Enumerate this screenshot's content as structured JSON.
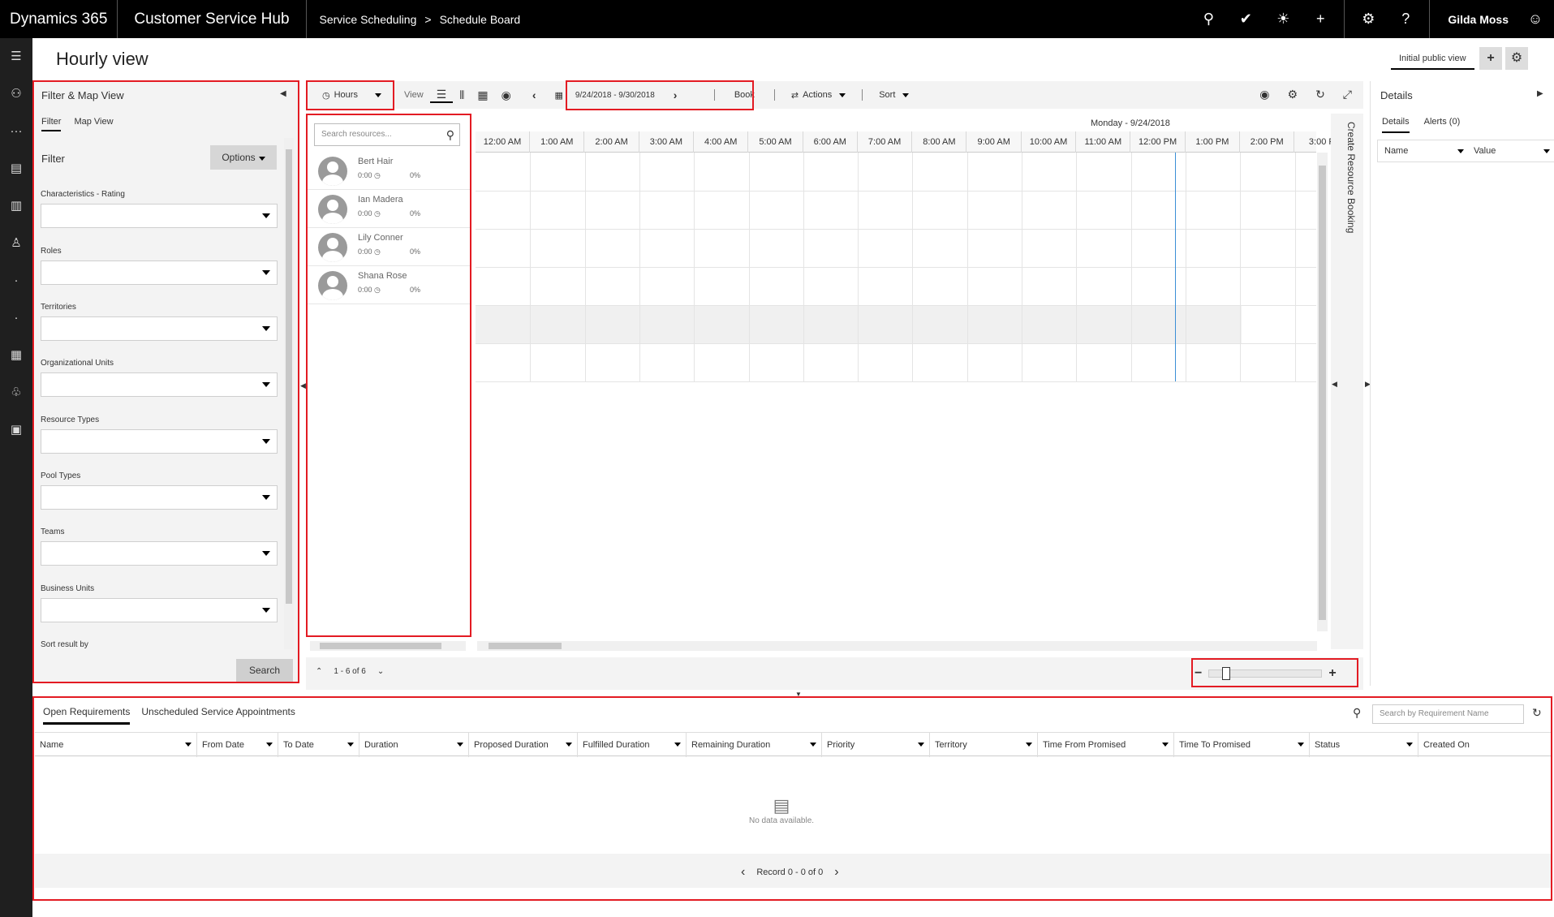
{
  "topbar": {
    "brand": "Dynamics 365",
    "app": "Customer Service Hub",
    "breadcrumb_1": "Service Scheduling",
    "breadcrumb_sep": ">",
    "breadcrumb_2": "Schedule Board",
    "user": "Gilda Moss"
  },
  "page": {
    "title": "Hourly view",
    "view_name": "Initial public view",
    "add_label": "+",
    "settings_label": "⚙"
  },
  "filter": {
    "panel_title": "Filter & Map View",
    "tabs": [
      "Filter",
      "Map View"
    ],
    "heading": "Filter",
    "options_label": "Options",
    "fields": [
      "Characteristics - Rating",
      "Roles",
      "Territories",
      "Organizational Units",
      "Resource Types",
      "Pool Types",
      "Teams",
      "Business Units",
      "Sort result by"
    ],
    "search_label": "Search"
  },
  "toolbar": {
    "hours_label": "Hours",
    "view_label": "View",
    "date_range": "9/24/2018 - 9/30/2018",
    "book_label": "Book",
    "actions_label": "Actions",
    "sort_label": "Sort"
  },
  "resources": {
    "search_placeholder": "Search resources...",
    "items": [
      {
        "name": "Bert Hair",
        "hours": "0:00",
        "percent": "0%"
      },
      {
        "name": "Ian Madera",
        "hours": "0:00",
        "percent": "0%"
      },
      {
        "name": "Lily Conner",
        "hours": "0:00",
        "percent": "0%"
      },
      {
        "name": "Shana Rose",
        "hours": "0:00",
        "percent": "0%"
      }
    ],
    "pager": "1 - 6 of 6"
  },
  "grid": {
    "day": "Monday - 9/24/2018",
    "hours": [
      "12:00 AM",
      "1:00 AM",
      "2:00 AM",
      "3:00 AM",
      "4:00 AM",
      "5:00 AM",
      "6:00 AM",
      "7:00 AM",
      "8:00 AM",
      "9:00 AM",
      "10:00 AM",
      "11:00 AM",
      "12:00 PM",
      "1:00 PM",
      "2:00 PM",
      "3:00 F"
    ],
    "create_booking": "Create Resource Booking"
  },
  "details": {
    "title": "Details",
    "tabs": [
      "Details",
      "Alerts (0)"
    ],
    "col_name": "Name",
    "col_value": "Value"
  },
  "requirements": {
    "tabs": [
      "Open Requirements",
      "Unscheduled Service Appointments"
    ],
    "search_placeholder": "Search by Requirement Name",
    "columns": [
      "Name",
      "From Date",
      "To Date",
      "Duration",
      "Proposed Duration",
      "Fulfilled Duration",
      "Remaining Duration",
      "Priority",
      "Territory",
      "Time From Promised",
      "Time To Promised",
      "Status",
      "Created On"
    ],
    "no_data": "No data available.",
    "record": "Record 0 - 0 of 0"
  },
  "colors": {
    "topbar": "#000000",
    "leftnav": "#1f1f1f",
    "highlight": "#e31b23",
    "nowline": "#3b8fd6"
  }
}
